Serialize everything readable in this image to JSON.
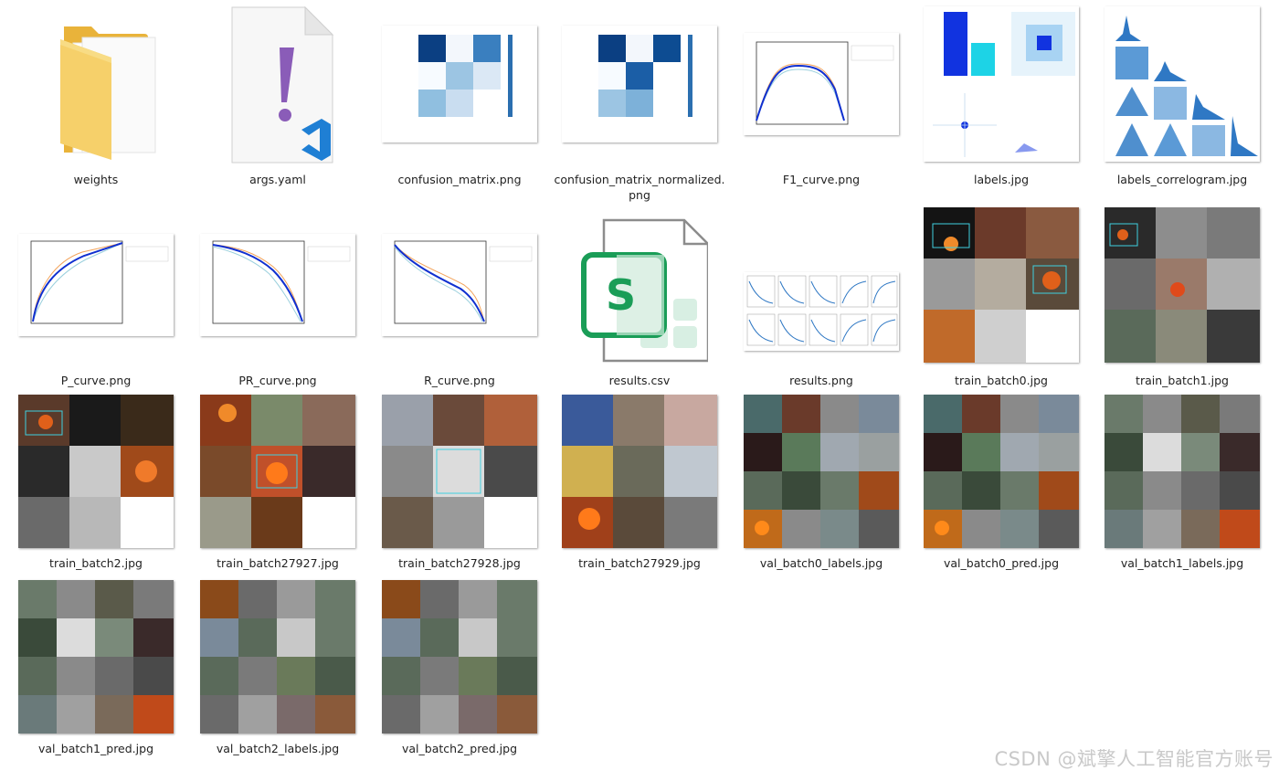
{
  "files": [
    {
      "name": "weights",
      "kind": "folder"
    },
    {
      "name": "args.yaml",
      "kind": "yaml"
    },
    {
      "name": "confusion_matrix.png",
      "kind": "confusion"
    },
    {
      "name": "confusion_matrix_normalized.png",
      "kind": "confusion"
    },
    {
      "name": "F1_curve.png",
      "kind": "curve"
    },
    {
      "name": "labels.jpg",
      "kind": "labels"
    },
    {
      "name": "labels_correlogram.jpg",
      "kind": "correlogram"
    },
    {
      "name": "P_curve.png",
      "kind": "curve"
    },
    {
      "name": "PR_curve.png",
      "kind": "curve"
    },
    {
      "name": "R_curve.png",
      "kind": "curve"
    },
    {
      "name": "results.csv",
      "kind": "csv"
    },
    {
      "name": "results.png",
      "kind": "results"
    },
    {
      "name": "train_batch0.jpg",
      "kind": "mosaic"
    },
    {
      "name": "train_batch1.jpg",
      "kind": "mosaic"
    },
    {
      "name": "train_batch2.jpg",
      "kind": "mosaic"
    },
    {
      "name": "train_batch27927.jpg",
      "kind": "mosaic"
    },
    {
      "name": "train_batch27928.jpg",
      "kind": "mosaic"
    },
    {
      "name": "train_batch27929.jpg",
      "kind": "mosaic"
    },
    {
      "name": "val_batch0_labels.jpg",
      "kind": "mosaic"
    },
    {
      "name": "val_batch0_pred.jpg",
      "kind": "mosaic"
    },
    {
      "name": "val_batch1_labels.jpg",
      "kind": "mosaic"
    },
    {
      "name": "val_batch1_pred.jpg",
      "kind": "mosaic"
    },
    {
      "name": "val_batch2_labels.jpg",
      "kind": "mosaic"
    },
    {
      "name": "val_batch2_pred.jpg",
      "kind": "mosaic"
    }
  ],
  "watermark": "CSDN @斌擎人工智能官方账号",
  "colors": {
    "folder": "#f3c548",
    "vscode": "#1f7fd4",
    "yaml_mark": "#8a5cb8",
    "wps_green": "#1a9d57",
    "curve_blue": "#1030d0"
  }
}
